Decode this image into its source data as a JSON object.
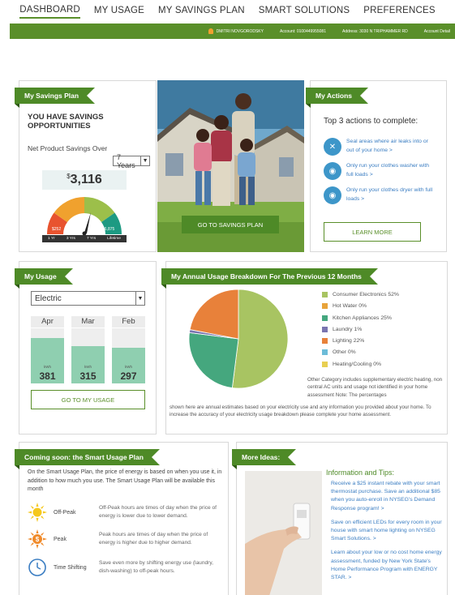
{
  "nav": {
    "items": [
      "DASHBOARD",
      "MY USAGE",
      "MY SAVINGS PLAN",
      "SMART SOLUTIONS",
      "PREFERENCES"
    ],
    "active": "DASHBOARD"
  },
  "account_bar": {
    "user": "DMITRI NOVGORODSKY",
    "account": "Account: 0100449955081",
    "address": "Address: 3030 N TRIPHAMMER RD",
    "details": "Account Detail"
  },
  "savings_plan": {
    "title": "My Savings Plan",
    "headline": "YOU HAVE SAVINGS OPPORTUNITIES",
    "net_label": "Net Product Savings Over",
    "period": "7 Years",
    "currency": "$",
    "amount": "3,116",
    "gauge_low": "$252",
    "gauge_high": "$6,875",
    "gauge_periods": [
      "1 Yr",
      "3 Yrs",
      "7 Yrs",
      "Lifetime"
    ]
  },
  "hero": {
    "button": "GO TO SAVINGS PLAN"
  },
  "actions": {
    "title": "My Actions",
    "heading": "Top 3 actions to complete:",
    "items": [
      "Seal areas where air leaks into or out of your home >",
      "Only run your clothes washer with full loads >",
      "Only run your clothes dryer with full loads >"
    ],
    "learn_more": "LEARN MORE"
  },
  "usage": {
    "title": "My Usage",
    "fuel": "Electric",
    "unit": "kWh",
    "months": [
      {
        "label": "Apr",
        "value": 381,
        "fill": 0.82,
        "track": 0.9
      },
      {
        "label": "Mar",
        "value": 315,
        "fill": 0.68,
        "track": 0.9
      },
      {
        "label": "Feb",
        "value": 297,
        "fill": 0.64,
        "track": 0.9
      }
    ],
    "button": "GO TO MY USAGE"
  },
  "breakdown": {
    "title": "My Annual Usage Breakdown For The Previous 12 Months",
    "note_right": "Other Category includes supplementary electric heating, non central AC units and usage not identified in your home assessment Note: The percentages",
    "note_full": "shown here are annual estimates based on your electricity use and any information you provided about your home. To increase the accuracy of your electricity usage breakdown please complete your home assessment."
  },
  "chart_data": {
    "type": "pie",
    "categories": [
      "Consumer Electronics",
      "Hot Water",
      "Kitchen Appliances",
      "Laundry",
      "Lighting",
      "Other",
      "Heating/Cooling"
    ],
    "values": [
      52,
      0,
      25,
      1,
      22,
      0,
      0
    ],
    "labels": [
      "Consumer Electronics 52%",
      "Hot Water 0%",
      "Kitchen Appliances 25%",
      "Laundry 1%",
      "Lighting 22%",
      "Other 0%",
      "Heating/Cooling 0%"
    ],
    "colors": [
      "#a8c462",
      "#e8a33a",
      "#45a77e",
      "#7a75b0",
      "#e8813a",
      "#6cbcd8",
      "#e8cf52"
    ]
  },
  "smart_plan": {
    "title": "Coming soon: the Smart Usage Plan",
    "intro": "On the Smart Usage Plan, the price of energy is based on when you use it, in addition to how much you use. The Smart Usage Plan will be available this month",
    "rows": [
      {
        "label": "Off-Peak",
        "desc": "Off-Peak hours are times of day when the price of energy is lower due to lower demand."
      },
      {
        "label": "Peak",
        "desc": "Peak hours are times of day when the price of energy is higher due to higher demand."
      },
      {
        "label": "Time Shifting",
        "desc": "Save even more by shifting energy use (laundry, dish-washing) to off-peak hours."
      }
    ]
  },
  "ideas": {
    "title": "More Ideas:",
    "heading": "Information and Tips:",
    "tips": [
      "Receive a $25 instant rebate with your smart thermostat purchase. Save an additional $85 when you auto-enroll in NYSEG's Demand Response program! >",
      "Save on efficient LEDs for every room in your house with smart home lighting on NYSEG Smart Solutions. >",
      "Learn about your low or no cost home energy assessment, funded by New York State's Home Performance Program with ENERGY STAR. >"
    ]
  }
}
